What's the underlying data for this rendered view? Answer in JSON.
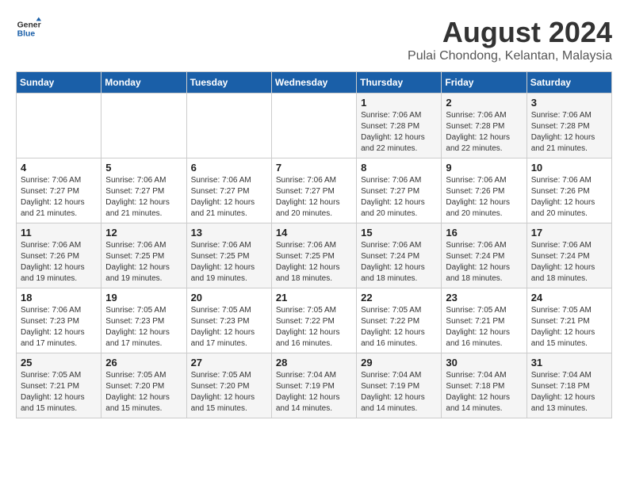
{
  "header": {
    "logo_line1": "General",
    "logo_line2": "Blue",
    "title": "August 2024",
    "subtitle": "Pulai Chondong, Kelantan, Malaysia"
  },
  "days_of_week": [
    "Sunday",
    "Monday",
    "Tuesday",
    "Wednesday",
    "Thursday",
    "Friday",
    "Saturday"
  ],
  "weeks": [
    [
      {
        "day": "",
        "info": ""
      },
      {
        "day": "",
        "info": ""
      },
      {
        "day": "",
        "info": ""
      },
      {
        "day": "",
        "info": ""
      },
      {
        "day": "1",
        "info": "Sunrise: 7:06 AM\nSunset: 7:28 PM\nDaylight: 12 hours\nand 22 minutes."
      },
      {
        "day": "2",
        "info": "Sunrise: 7:06 AM\nSunset: 7:28 PM\nDaylight: 12 hours\nand 22 minutes."
      },
      {
        "day": "3",
        "info": "Sunrise: 7:06 AM\nSunset: 7:28 PM\nDaylight: 12 hours\nand 21 minutes."
      }
    ],
    [
      {
        "day": "4",
        "info": "Sunrise: 7:06 AM\nSunset: 7:27 PM\nDaylight: 12 hours\nand 21 minutes."
      },
      {
        "day": "5",
        "info": "Sunrise: 7:06 AM\nSunset: 7:27 PM\nDaylight: 12 hours\nand 21 minutes."
      },
      {
        "day": "6",
        "info": "Sunrise: 7:06 AM\nSunset: 7:27 PM\nDaylight: 12 hours\nand 21 minutes."
      },
      {
        "day": "7",
        "info": "Sunrise: 7:06 AM\nSunset: 7:27 PM\nDaylight: 12 hours\nand 20 minutes."
      },
      {
        "day": "8",
        "info": "Sunrise: 7:06 AM\nSunset: 7:27 PM\nDaylight: 12 hours\nand 20 minutes."
      },
      {
        "day": "9",
        "info": "Sunrise: 7:06 AM\nSunset: 7:26 PM\nDaylight: 12 hours\nand 20 minutes."
      },
      {
        "day": "10",
        "info": "Sunrise: 7:06 AM\nSunset: 7:26 PM\nDaylight: 12 hours\nand 20 minutes."
      }
    ],
    [
      {
        "day": "11",
        "info": "Sunrise: 7:06 AM\nSunset: 7:26 PM\nDaylight: 12 hours\nand 19 minutes."
      },
      {
        "day": "12",
        "info": "Sunrise: 7:06 AM\nSunset: 7:25 PM\nDaylight: 12 hours\nand 19 minutes."
      },
      {
        "day": "13",
        "info": "Sunrise: 7:06 AM\nSunset: 7:25 PM\nDaylight: 12 hours\nand 19 minutes."
      },
      {
        "day": "14",
        "info": "Sunrise: 7:06 AM\nSunset: 7:25 PM\nDaylight: 12 hours\nand 18 minutes."
      },
      {
        "day": "15",
        "info": "Sunrise: 7:06 AM\nSunset: 7:24 PM\nDaylight: 12 hours\nand 18 minutes."
      },
      {
        "day": "16",
        "info": "Sunrise: 7:06 AM\nSunset: 7:24 PM\nDaylight: 12 hours\nand 18 minutes."
      },
      {
        "day": "17",
        "info": "Sunrise: 7:06 AM\nSunset: 7:24 PM\nDaylight: 12 hours\nand 18 minutes."
      }
    ],
    [
      {
        "day": "18",
        "info": "Sunrise: 7:06 AM\nSunset: 7:23 PM\nDaylight: 12 hours\nand 17 minutes."
      },
      {
        "day": "19",
        "info": "Sunrise: 7:05 AM\nSunset: 7:23 PM\nDaylight: 12 hours\nand 17 minutes."
      },
      {
        "day": "20",
        "info": "Sunrise: 7:05 AM\nSunset: 7:23 PM\nDaylight: 12 hours\nand 17 minutes."
      },
      {
        "day": "21",
        "info": "Sunrise: 7:05 AM\nSunset: 7:22 PM\nDaylight: 12 hours\nand 16 minutes."
      },
      {
        "day": "22",
        "info": "Sunrise: 7:05 AM\nSunset: 7:22 PM\nDaylight: 12 hours\nand 16 minutes."
      },
      {
        "day": "23",
        "info": "Sunrise: 7:05 AM\nSunset: 7:21 PM\nDaylight: 12 hours\nand 16 minutes."
      },
      {
        "day": "24",
        "info": "Sunrise: 7:05 AM\nSunset: 7:21 PM\nDaylight: 12 hours\nand 15 minutes."
      }
    ],
    [
      {
        "day": "25",
        "info": "Sunrise: 7:05 AM\nSunset: 7:21 PM\nDaylight: 12 hours\nand 15 minutes."
      },
      {
        "day": "26",
        "info": "Sunrise: 7:05 AM\nSunset: 7:20 PM\nDaylight: 12 hours\nand 15 minutes."
      },
      {
        "day": "27",
        "info": "Sunrise: 7:05 AM\nSunset: 7:20 PM\nDaylight: 12 hours\nand 15 minutes."
      },
      {
        "day": "28",
        "info": "Sunrise: 7:04 AM\nSunset: 7:19 PM\nDaylight: 12 hours\nand 14 minutes."
      },
      {
        "day": "29",
        "info": "Sunrise: 7:04 AM\nSunset: 7:19 PM\nDaylight: 12 hours\nand 14 minutes."
      },
      {
        "day": "30",
        "info": "Sunrise: 7:04 AM\nSunset: 7:18 PM\nDaylight: 12 hours\nand 14 minutes."
      },
      {
        "day": "31",
        "info": "Sunrise: 7:04 AM\nSunset: 7:18 PM\nDaylight: 12 hours\nand 13 minutes."
      }
    ]
  ]
}
